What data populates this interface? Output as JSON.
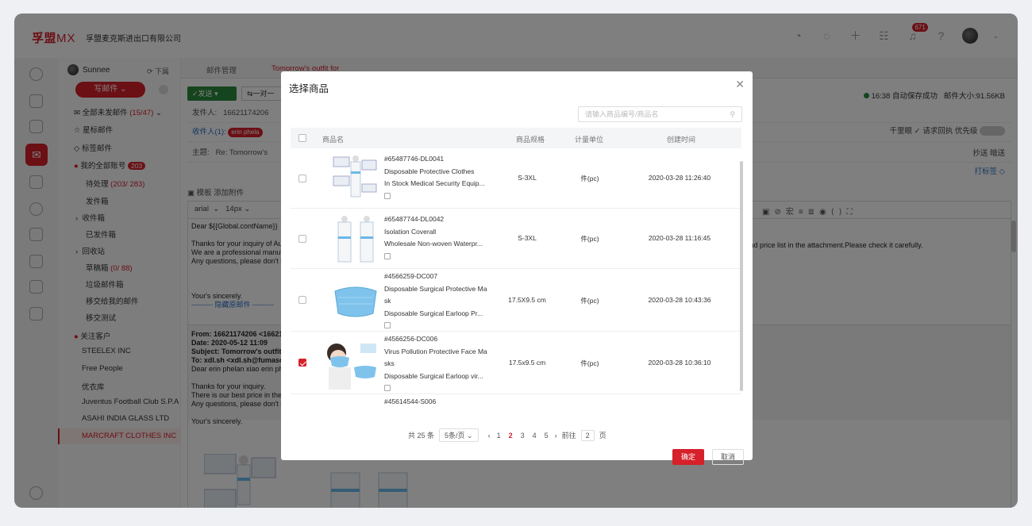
{
  "app": {
    "logo_cn": "孚盟",
    "logo_mx": "MX",
    "company": "孚盟麦克斯进出口有限公司",
    "notification_count": "671"
  },
  "sidebar": {
    "user": "Sunnee",
    "download": "下属",
    "compose": "写邮件",
    "items": [
      {
        "label": "全部未发邮件",
        "count": "(15/47)"
      },
      {
        "label": "星标邮件"
      },
      {
        "label": "标签邮件"
      },
      {
        "label": "我的全部账号",
        "badge": "203"
      },
      {
        "label": "待处理",
        "count": "(203/ 283)"
      },
      {
        "label": "发件箱"
      },
      {
        "label": "收件箱"
      },
      {
        "label": "已发件箱"
      },
      {
        "label": "回收站"
      },
      {
        "label": "草稿箱",
        "count": "(0/ 88)"
      },
      {
        "label": "垃圾邮件箱"
      },
      {
        "label": "移交给我的邮件"
      },
      {
        "label": "移交测试"
      },
      {
        "label": "关注客户"
      },
      {
        "label": "STEELEX INC"
      },
      {
        "label": "Free People"
      },
      {
        "label": "优衣库"
      },
      {
        "label": "Juventus Football Club S.P.A"
      },
      {
        "label": "ASAHI INDIA GLASS LTD"
      },
      {
        "label": "MARCRAFT CLOTHES INC"
      }
    ]
  },
  "main": {
    "tabs": [
      "邮件管理",
      "Tomorrow's outfit for"
    ],
    "send": "发送",
    "reply_one": "一对一",
    "autosave": "16:38 自动保存成功",
    "mail_size": "邮件大小:91.56KB",
    "sender_label": "发件人:",
    "sender_value": "16621174206",
    "recipient_label": "收件人(1):",
    "recipient_chip": "erin phela",
    "subject_label": "主题:",
    "subject_value": "Re: Tomorrow's",
    "options": "千里眼  ✓ 请求回执  优先级",
    "cc": "抄送  暗送",
    "tag": "打标签",
    "tools": "模板  添加附件",
    "font": "arial",
    "fontsize": "14px",
    "body_lines": [
      "Dear ${{Global.contName}}",
      "",
      "Thanks for your inquiry of Au",
      "We are a professional manuf",
      "Any questions, please don't h",
      "",
      "",
      "",
      "Your's sincerely.",
      "--------- 隐藏原邮件 ---------"
    ],
    "body_right": "og and price list in the attachment.Please check it carefully.",
    "quote_lines": [
      "From: 16621174206 <16621",
      "Date: 2020-05-12 11:09",
      "Subject: Tomorrow's outfit fo",
      "To: xdl.sh <xdl.sh@fumasoft",
      "Dear erin phelan xiao erin ph",
      "",
      "Thanks for your inquiry.",
      "There is our best price in the",
      "Any questions, please don't h",
      "",
      "Your's sincerely."
    ]
  },
  "modal": {
    "title": "选择商品",
    "search_placeholder": "请输入商品编号/商品名",
    "headers": {
      "name": "商品名",
      "spec": "商品规格",
      "unit": "计量单位",
      "created": "创建时间"
    },
    "rows": [
      {
        "code": "#65487746-DL0041",
        "name": "Disposable Protective Clothes",
        "desc": "In Stock Medical Security Equip...",
        "spec": "S-3XL",
        "unit": "件(pc)",
        "created": "2020-03-28 11:26:40",
        "checked": false
      },
      {
        "code": "#65487744-DL0042",
        "name": "Isolation Coverall",
        "desc": "Wholesale Non-woven Waterpr...",
        "spec": "S-3XL",
        "unit": "件(pc)",
        "created": "2020-03-28 11:16:45",
        "checked": false
      },
      {
        "code": "#4566259-DC007",
        "name": "Disposable Surgical Protective Ma",
        "name2": "sk",
        "desc": "Disposable Surgical Earloop Pr...",
        "spec": "17.5X9.5 cm",
        "unit": "件(pc)",
        "created": "2020-03-28 10:43:36",
        "checked": false
      },
      {
        "code": "#4566256-DC006",
        "name": "Virus Pollution Protective Face Ma",
        "name2": "sks",
        "desc": "Disposable Surgical Earloop vir...",
        "spec": "17.5x9.5 cm",
        "unit": "件(pc)",
        "created": "2020-03-28 10:36:10",
        "checked": true
      },
      {
        "code": "#45614544-S006",
        "name": "",
        "desc": "",
        "spec": "",
        "unit": "",
        "created": "",
        "checked": false
      }
    ],
    "pager": {
      "total": "共 25 条",
      "per_page": "5条/页",
      "pages": [
        "1",
        "2",
        "3",
        "4",
        "5"
      ],
      "current": "2",
      "goto": "前往",
      "goto_value": "2",
      "page_suffix": "页"
    },
    "ok": "确定",
    "cancel": "取消"
  }
}
